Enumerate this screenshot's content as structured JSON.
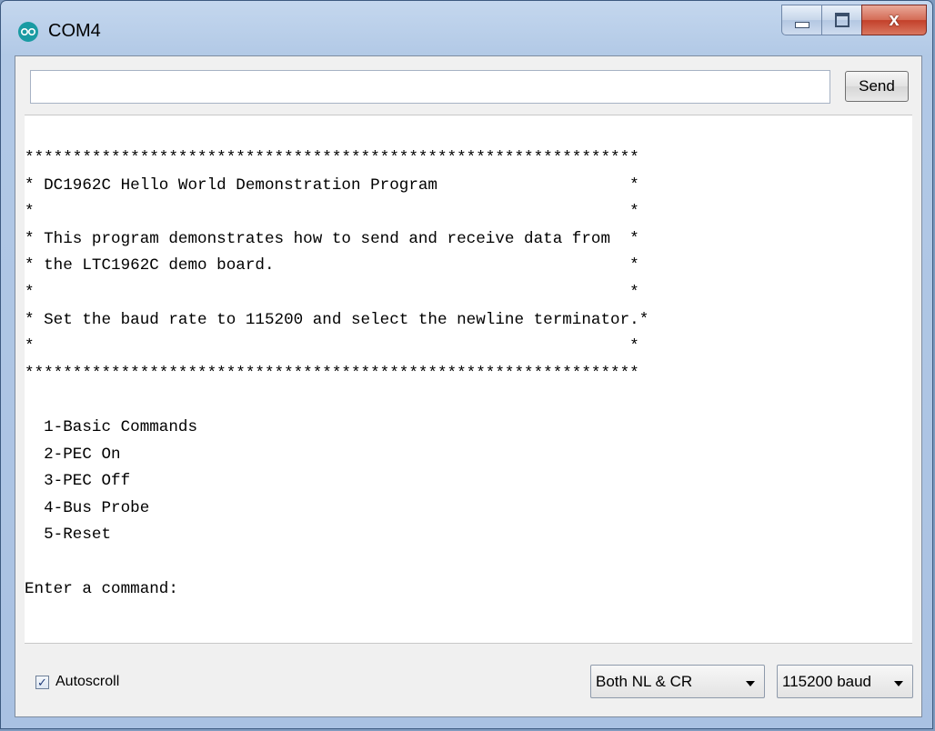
{
  "window": {
    "title": "COM4",
    "close_symbol": "x"
  },
  "input": {
    "value": "",
    "send_label": "Send"
  },
  "monitor": {
    "lines": [
      "****************************************************************",
      "* DC1962C Hello World Demonstration Program                    *",
      "*                                                              *",
      "* This program demonstrates how to send and receive data from  *",
      "* the LTC1962C demo board.                                     *",
      "*                                                              *",
      "* Set the baud rate to 115200 and select the newline terminator.*",
      "*                                                              *",
      "****************************************************************",
      "",
      "  1-Basic Commands",
      "  2-PEC On",
      "  3-PEC Off",
      "  4-Bus Probe",
      "  5-Reset",
      "",
      "Enter a command:"
    ]
  },
  "footer": {
    "autoscroll_label": "Autoscroll",
    "autoscroll_checked": true,
    "check_glyph": "✓",
    "line_ending": "Both NL & CR",
    "baud_rate": "115200 baud"
  },
  "icons": {
    "app": "arduino-infinity-icon",
    "minimize": "minimize-icon",
    "maximize": "maximize-icon",
    "close": "close-icon",
    "dropdown": "chevron-down-icon"
  }
}
